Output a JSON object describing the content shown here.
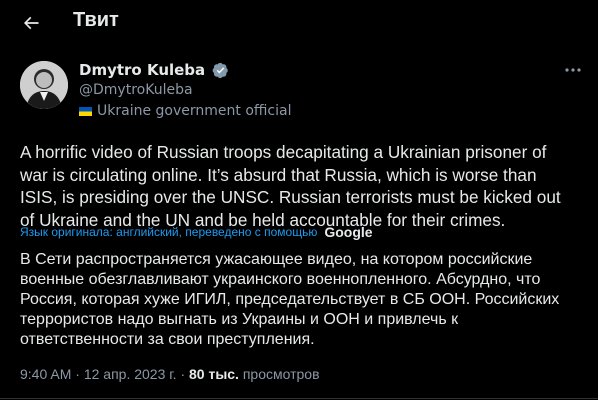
{
  "header": {
    "title": "Твит",
    "back_icon": "arrow-left-icon"
  },
  "author": {
    "name": "Dmytro Kuleba",
    "handle": "@DmytroKuleba",
    "affiliation": "Ukraine government official",
    "verified_color": "#829aab"
  },
  "tweet": {
    "text": "A horrific video of Russian troops decapitating a Ukrainian prisoner of war is circulating online. It’s absurd that Russia, which is worse than ISIS, is presiding over the UNSC. Russian terrorists must be kicked out of Ukraine and the UN and be held accountable for their crimes.",
    "translation_note": "Язык оригинала: английский, переведено с помощью",
    "translation_provider": "Google",
    "translated_text": "В Сети распространяется ужасающее видео, на котором российские военные обезглавливают украинского военнопленного. Абсурдно, что Россия, которая хуже ИГИЛ, председательствует в СБ ООН. Российских террористов надо выгнать из Украины и ООН и привлечь к ответственности за свои преступления."
  },
  "meta": {
    "time": "9:40 AM",
    "separator": "·",
    "date": "12 апр. 2023 г.",
    "views_count": "80 тыс.",
    "views_label": "просмотров"
  },
  "colors": {
    "background": "#000000",
    "text": "#e7e9ea",
    "secondary": "#8b98a5",
    "link": "#1d9bf0"
  }
}
